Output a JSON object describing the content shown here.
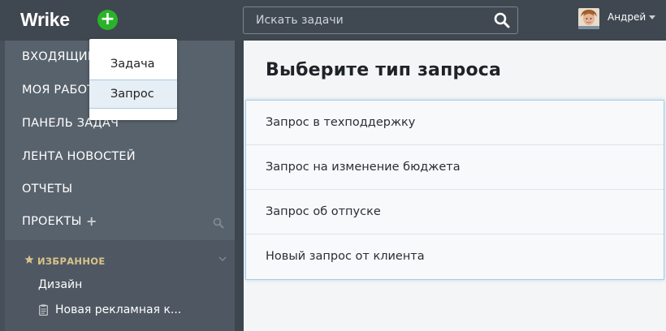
{
  "header": {
    "logo": "Wrike",
    "add_symbol": "+",
    "search_placeholder": "Искать задачи",
    "user_name": "Андрей"
  },
  "add_menu": {
    "items": [
      {
        "label": "Задача"
      },
      {
        "label": "Запрос",
        "selected": true
      }
    ]
  },
  "sidebar": {
    "items": [
      {
        "label": "ВХОДЯЩИЕ"
      },
      {
        "label": "МОЯ РАБОТА"
      },
      {
        "label": "ПАНЕЛЬ ЗАДАЧ"
      },
      {
        "label": "ЛЕНТА НОВОСТЕЙ"
      },
      {
        "label": "ОТЧЕТЫ"
      },
      {
        "label": "ПРОЕКТЫ"
      }
    ],
    "favorites": {
      "label": "ИЗБРАННОЕ",
      "items": [
        {
          "label": "Дизайн"
        },
        {
          "label": "Новая рекламная к..."
        }
      ]
    }
  },
  "main": {
    "title": "Выберите тип запроса",
    "request_types": [
      {
        "label": "Запрос в техподдержку"
      },
      {
        "label": "Запрос на изменение бюджета"
      },
      {
        "label": "Запрос об отпуске"
      },
      {
        "label": "Новый запрос от клиента"
      }
    ]
  },
  "colors": {
    "topbar": "#3f4750",
    "sidebar": "#58626c",
    "accent_green": "#2ab32a",
    "favorites_label": "#d8c28a"
  }
}
